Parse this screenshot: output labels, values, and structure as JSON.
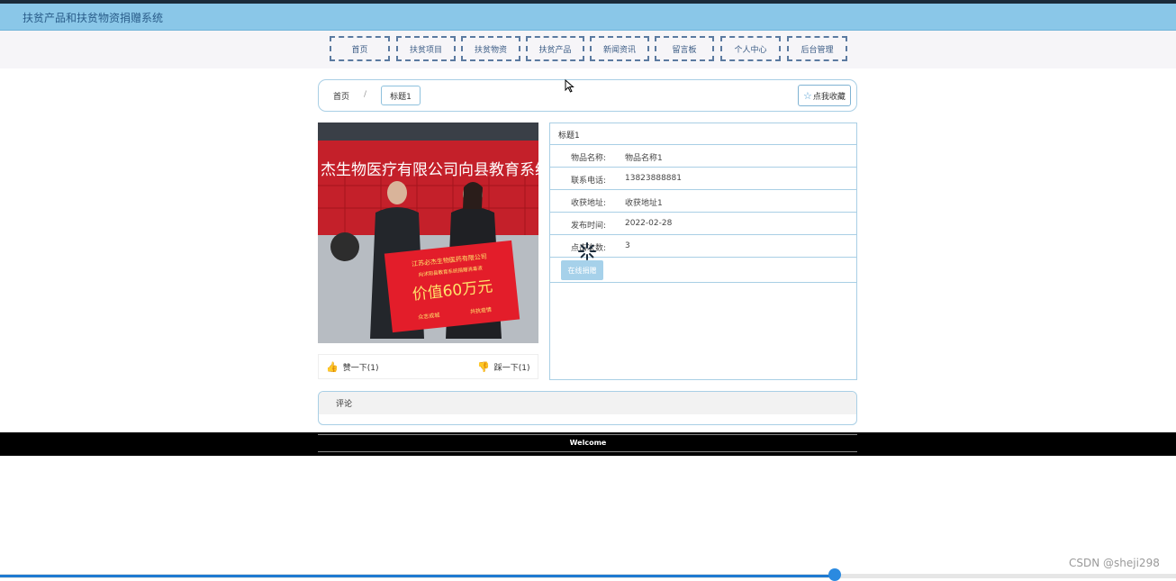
{
  "app": {
    "title": "扶贫产品和扶贫物资捐赠系统"
  },
  "nav": [
    {
      "label": "首页"
    },
    {
      "label": "扶贫项目"
    },
    {
      "label": "扶贫物资"
    },
    {
      "label": "扶贫产品"
    },
    {
      "label": "新闻资讯"
    },
    {
      "label": "留言板"
    },
    {
      "label": "个人中心"
    },
    {
      "label": "后台管理"
    }
  ],
  "breadcrumb": {
    "home": "首页",
    "separator": "/",
    "current": "标题1"
  },
  "favorite_label": "点我收藏",
  "photo": {
    "banner_text": "杰生物医疗有限公司向县教育系统",
    "sign_company": "江苏必杰生物医药有限公司",
    "sign_sub": "向沭阳县教育系统捐赠消毒液",
    "sign_value": "价值60万元",
    "sign_slogan_left": "众志成城",
    "sign_slogan_right": "共抗疫情"
  },
  "likes": {
    "like_label": "赞一下(1)",
    "dislike_label": "踩一下(1)"
  },
  "detail": {
    "title": "标题1",
    "rows": [
      {
        "label": "物品名称:",
        "value": "物品名称1"
      },
      {
        "label": "联系电话:",
        "value": "13823888881"
      },
      {
        "label": "收获地址:",
        "value": "收获地址1"
      },
      {
        "label": "发布时间:",
        "value": "2022-02-28"
      },
      {
        "label": "点击次数:",
        "value": "3"
      }
    ],
    "donate_label": "在线捐赠"
  },
  "comment": {
    "title": "评论"
  },
  "footer": {
    "welcome": "Welcome"
  },
  "watermark": "CSDN @sheji298",
  "colors": {
    "title_bar": "#8ac7e8",
    "nav_border": "#5b7aa0",
    "accent": "#a9cfe5",
    "footer": "#000000"
  },
  "page_scroll_progress": 0.71
}
